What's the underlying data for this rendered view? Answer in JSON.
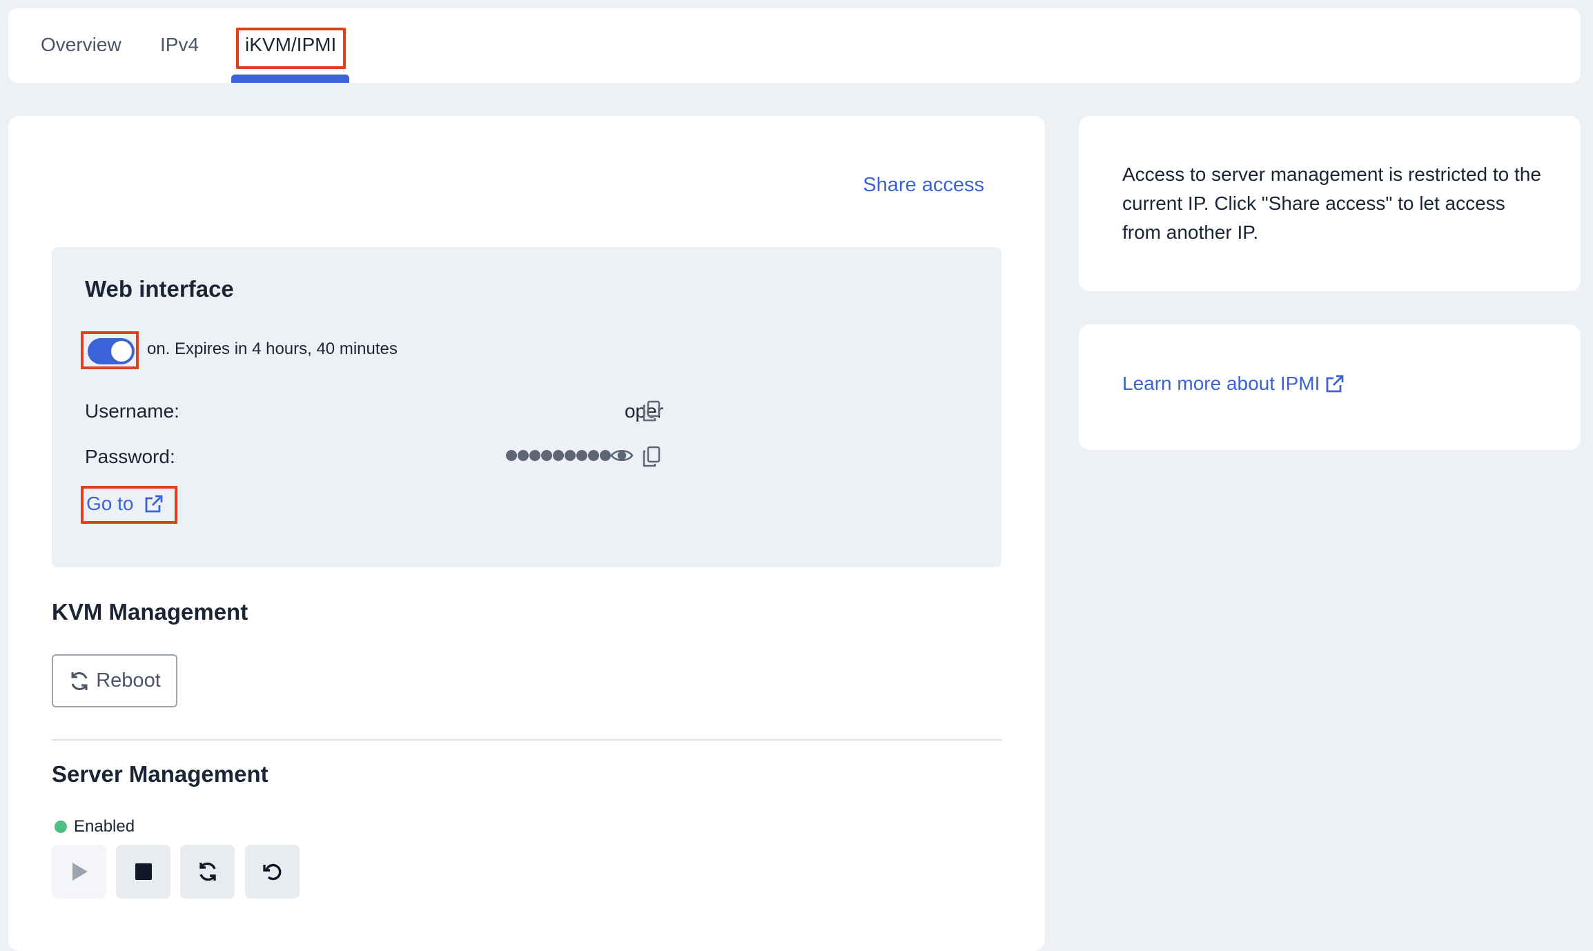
{
  "tabs": [
    {
      "label": "Overview"
    },
    {
      "label": "IPv4"
    },
    {
      "label": "iKVM/IPMI"
    }
  ],
  "main": {
    "share_access": "Share access",
    "web_interface": {
      "title": "Web interface",
      "toggle_state": "on",
      "toggle_text": "on. Expires in 4 hours, 40 minutes",
      "username_label": "Username:",
      "username_value": "oper",
      "password_label": "Password:",
      "password_masked_count": 9,
      "goto_label": "Go to"
    },
    "kvm": {
      "title": "KVM Management",
      "reboot_label": "Reboot"
    },
    "server": {
      "title": "Server Management",
      "status": "Enabled",
      "status_color": "#4bbf84"
    }
  },
  "side": {
    "info_text": "Access to server management is restricted to the current IP. Click \"Share access\" to let access from another IP.",
    "learn_more": "Learn more about IPMI"
  },
  "colors": {
    "accent": "#3b63d8",
    "highlight": "#e0401e",
    "background": "#edf0f5"
  }
}
